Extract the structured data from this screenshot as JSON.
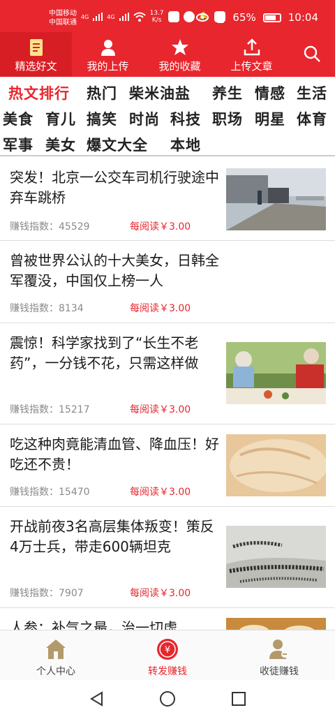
{
  "status": {
    "carrier1": "中国移动",
    "carrier2": "中国联通",
    "net1": "4G",
    "net2": "4G",
    "speed": "13.7",
    "speed_unit": "K/s",
    "battery": "65%",
    "time": "10:04"
  },
  "tabs": [
    {
      "label": "精选好文",
      "icon": "document-icon"
    },
    {
      "label": "我的上传",
      "icon": "person-icon"
    },
    {
      "label": "我的收藏",
      "icon": "star-icon"
    },
    {
      "label": "上传文章",
      "icon": "upload-icon"
    }
  ],
  "categories": [
    "热文排行",
    "热门",
    "柴米油盐",
    "养生",
    "情感",
    "生活",
    "美食",
    "育儿",
    "搞笑",
    "时尚",
    "科技",
    "职场",
    "明星",
    "体育",
    "军事",
    "美女",
    "爆文大全",
    "本地"
  ],
  "articles": [
    {
      "title": "突发！北京一公交车司机行驶途中弃车跳桥",
      "index_label": "赚钱指数：45529",
      "reward": "每阅读￥3.00"
    },
    {
      "title": "曾被世界公认的十大美女，日韩全军覆没，中国仅上榜一人",
      "index_label": "赚钱指数：8134",
      "reward": "每阅读￥3.00"
    },
    {
      "title": "震惊！科学家找到了“长生不老药”，一分钱不花，只需这样做",
      "index_label": "赚钱指数：15217",
      "reward": "每阅读￥3.00"
    },
    {
      "title": "吃这种肉竟能清血管、降血压！好吃还不贵！",
      "index_label": "赚钱指数：15470",
      "reward": "每阅读￥3.00"
    },
    {
      "title": "开战前夜3名高层集体叛变！策反4万士兵，带走600辆坦克",
      "index_label": "赚钱指数：7907",
      "reward": "每阅读￥3.00"
    },
    {
      "title": "人参：补气之最，治一切虚"
    }
  ],
  "bottom_nav": [
    {
      "label": "个人中心",
      "icon": "home-icon"
    },
    {
      "label": "转发赚钱",
      "icon": "yuan-coin-icon"
    },
    {
      "label": "收徒赚钱",
      "icon": "user-add-icon"
    }
  ],
  "colors": {
    "brand": "#e8262d",
    "text": "#1a1a1a",
    "muted": "#8a8a8a"
  }
}
